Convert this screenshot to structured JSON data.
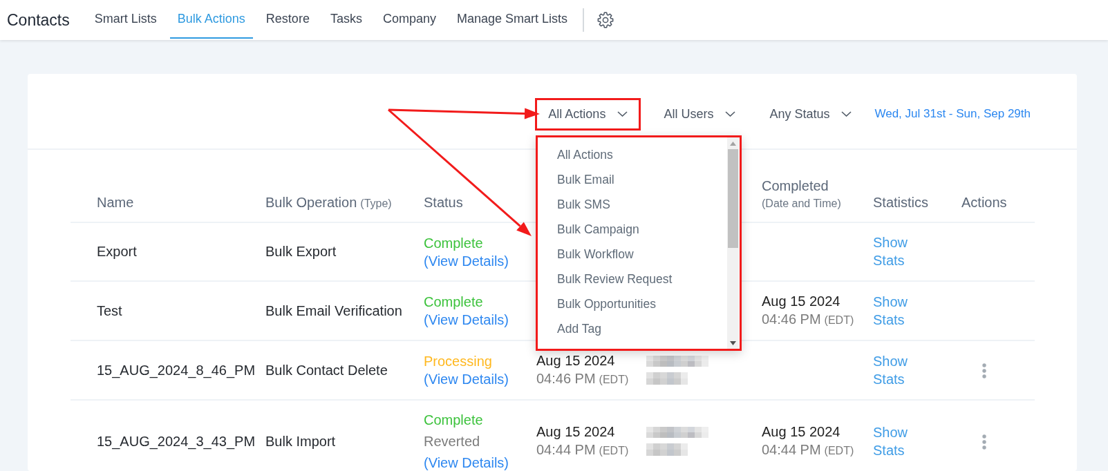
{
  "header": {
    "title": "Contacts",
    "tabs": [
      {
        "label": "Smart Lists",
        "selected": false
      },
      {
        "label": "Bulk Actions",
        "selected": true
      },
      {
        "label": "Restore",
        "selected": false
      },
      {
        "label": "Tasks",
        "selected": false
      },
      {
        "label": "Company",
        "selected": false
      },
      {
        "label": "Manage Smart Lists",
        "selected": false
      }
    ]
  },
  "filters": [
    {
      "label": "All Actions",
      "highlighted": true
    },
    {
      "label": "All Users",
      "highlighted": false
    },
    {
      "label": "Any Status",
      "highlighted": false
    }
  ],
  "date_range": "Wed, Jul 31st - Sun, Sep 29th",
  "actions_menu": {
    "expanded": true,
    "highlighted": true,
    "items": [
      "All Actions",
      "Bulk Email",
      "Bulk SMS",
      "Bulk Campaign",
      "Bulk Workflow",
      "Bulk Review Request",
      "Bulk Opportunities",
      "Add Tag"
    ]
  },
  "table": {
    "columns": [
      {
        "label": "Name"
      },
      {
        "label": "Bulk Operation",
        "note": "(Type)"
      },
      {
        "label": "Status"
      },
      {
        "label": "Completed",
        "note": "(Date and Time)"
      },
      {
        "label": "Statistics"
      },
      {
        "label": "Actions"
      }
    ],
    "rows": [
      {
        "name": "Export",
        "operation": "Bulk Export",
        "status": [
          {
            "kind": "complete",
            "text": "Complete"
          },
          {
            "kind": "link",
            "text": "(View Details)"
          }
        ],
        "statistics": "Show Stats",
        "menu": false
      },
      {
        "name": "Test",
        "operation": "Bulk Email Verification",
        "status": [
          {
            "kind": "complete",
            "text": "Complete"
          },
          {
            "kind": "link",
            "text": "(View Details)"
          }
        ],
        "completed": {
          "date": "Aug 15 2024",
          "time": "04:46 PM",
          "zone": "(EDT)"
        },
        "statistics": "Show Stats",
        "menu": false
      },
      {
        "name": "15_AUG_2024_8_46_PM",
        "operation": "Bulk Contact Delete",
        "status": [
          {
            "kind": "processing",
            "text": "Processing"
          },
          {
            "kind": "link",
            "text": "(View Details)"
          }
        ],
        "column_4": {
          "date": "Aug 15 2024",
          "time": "04:46 PM",
          "zone": "(EDT)"
        },
        "column_5": {
          "redacted": true
        },
        "statistics": "Show Stats",
        "menu": true
      },
      {
        "name": "15_AUG_2024_3_43_PM",
        "operation": "Bulk Import",
        "status": [
          {
            "kind": "complete",
            "text": "Complete"
          },
          {
            "kind": "reverted",
            "text": "Reverted"
          },
          {
            "kind": "link",
            "text": "(View Details)"
          }
        ],
        "column_4": {
          "date": "Aug 15 2024",
          "time": "04:44 PM",
          "zone": "(EDT)"
        },
        "column_5": {
          "redacted": true
        },
        "completed": {
          "date": "Aug 15 2024",
          "time": "04:44 PM",
          "zone": "(EDT)"
        },
        "statistics": "Show Stats",
        "menu": true
      }
    ]
  }
}
